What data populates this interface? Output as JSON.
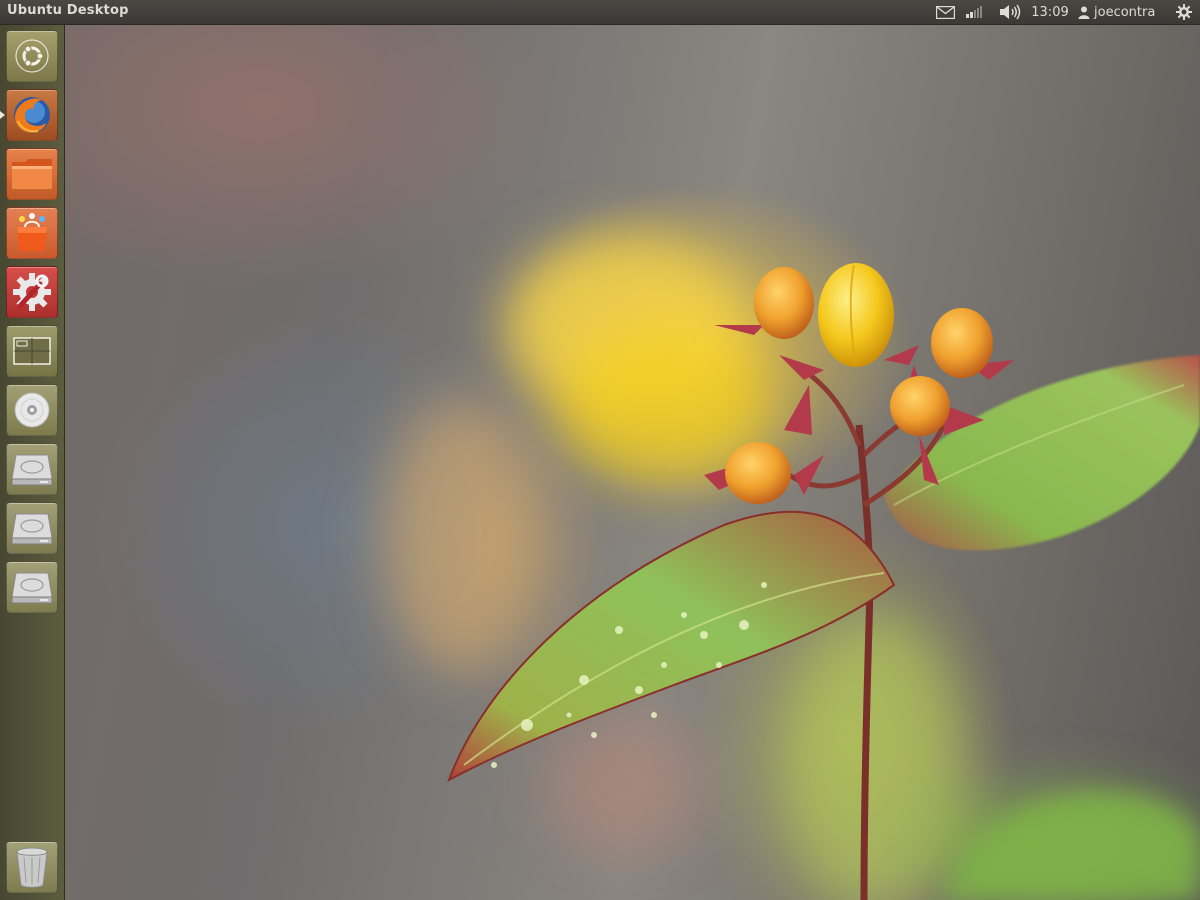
{
  "top_panel": {
    "app_title": "Ubuntu Desktop",
    "indicators": {
      "mail_icon": "envelope-icon",
      "network_icon": "network-signal-icon",
      "sound_icon": "speaker-volume-icon",
      "clock": "13:09",
      "user_icon": "person-icon",
      "username": "joecontra",
      "session_icon": "gear-power-icon"
    }
  },
  "launcher": {
    "items": [
      {
        "name": "Dash home",
        "icon": "ubuntu-logo-icon",
        "running": false
      },
      {
        "name": "Firefox Web Browser",
        "icon": "firefox-icon",
        "running": true
      },
      {
        "name": "Home Folder",
        "icon": "folder-icon",
        "running": false
      },
      {
        "name": "Ubuntu Software Center",
        "icon": "shopping-bag-icon",
        "running": false
      },
      {
        "name": "System Settings",
        "icon": "wrench-gear-icon",
        "running": false
      },
      {
        "name": "Workspace Switcher",
        "icon": "workspaces-icon",
        "running": false
      },
      {
        "name": "CD/DVD Drive",
        "icon": "disc-icon",
        "running": false
      },
      {
        "name": "Hard Drive 1",
        "icon": "hard-drive-icon",
        "running": false
      },
      {
        "name": "Hard Drive 2",
        "icon": "hard-drive-icon",
        "running": false
      },
      {
        "name": "Hard Drive 3",
        "icon": "hard-drive-icon",
        "running": false
      },
      {
        "name": "Trash",
        "icon": "trash-icon",
        "running": false
      }
    ]
  },
  "wallpaper": {
    "subject": "flower buds and leaves with water droplets"
  },
  "colors": {
    "panel_bg": "#3c3b37",
    "panel_text": "#dfdbd2",
    "launcher_bg": "#5c5c3e",
    "accent_orange": "#dd4814"
  }
}
